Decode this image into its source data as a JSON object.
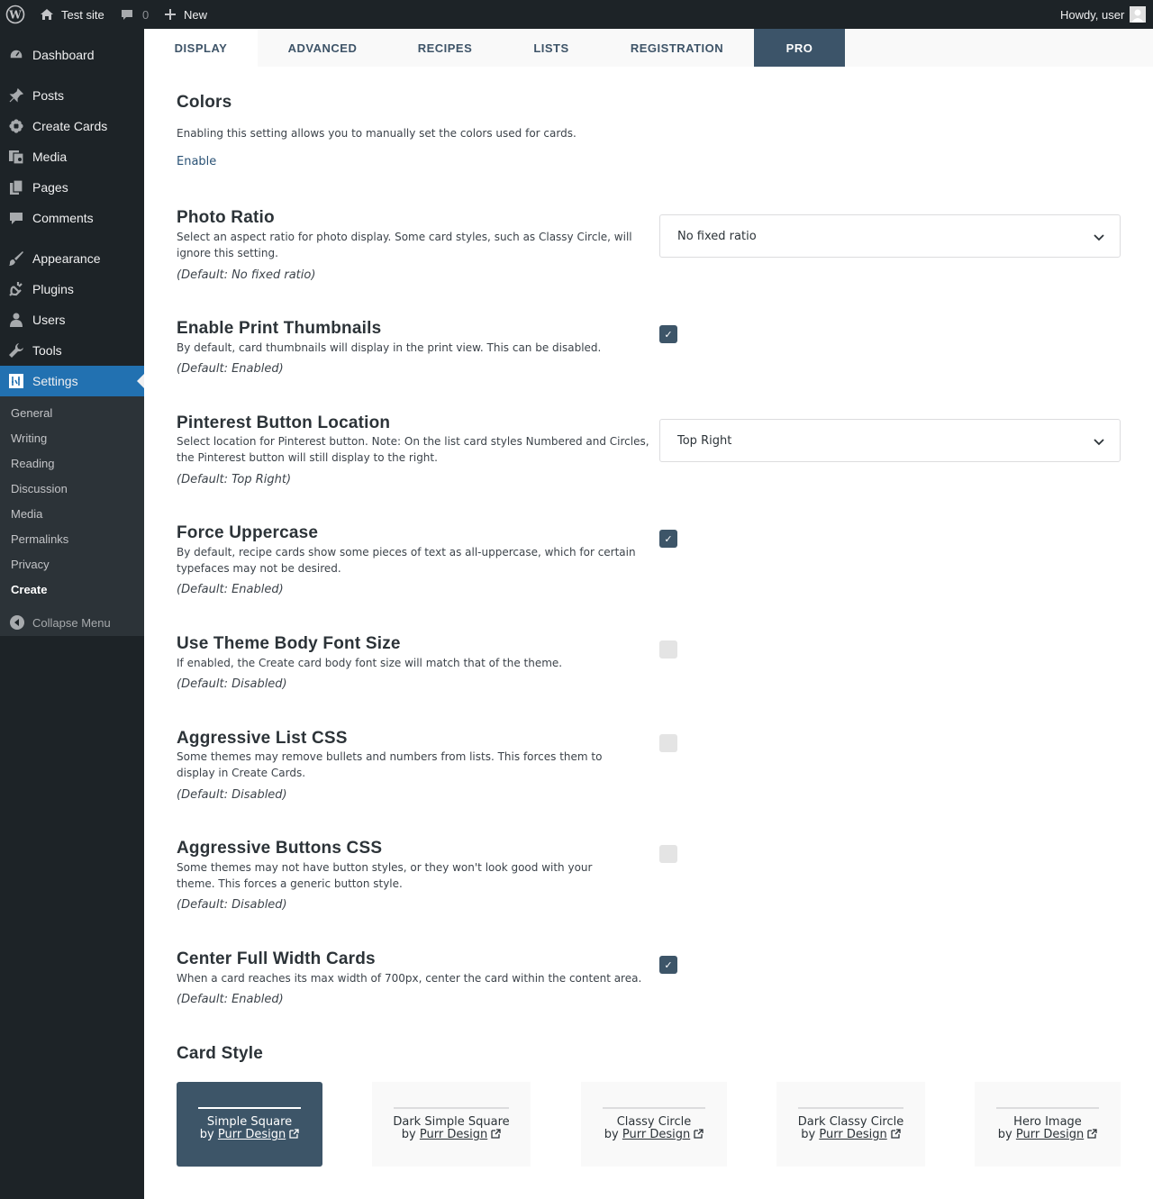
{
  "adminbar": {
    "site_name": "Test site",
    "comments_count": "0",
    "new_label": "New",
    "greeting": "Howdy, user"
  },
  "sidebar": {
    "items": [
      {
        "label": "Dashboard",
        "icon": "dashboard-icon"
      },
      {
        "label": "Posts",
        "icon": "pin-icon"
      },
      {
        "label": "Create Cards",
        "icon": "flower-icon"
      },
      {
        "label": "Media",
        "icon": "media-icon"
      },
      {
        "label": "Pages",
        "icon": "pages-icon"
      },
      {
        "label": "Comments",
        "icon": "comment-icon"
      },
      {
        "label": "Appearance",
        "icon": "brush-icon"
      },
      {
        "label": "Plugins",
        "icon": "plug-icon"
      },
      {
        "label": "Users",
        "icon": "user-icon"
      },
      {
        "label": "Tools",
        "icon": "wrench-icon"
      },
      {
        "label": "Settings",
        "icon": "settings-icon"
      }
    ],
    "submenu": [
      "General",
      "Writing",
      "Reading",
      "Discussion",
      "Media",
      "Permalinks",
      "Privacy",
      "Create"
    ],
    "collapse_label": "Collapse Menu"
  },
  "tabs": [
    "DISPLAY",
    "ADVANCED",
    "RECIPES",
    "LISTS",
    "REGISTRATION",
    "PRO"
  ],
  "colors": {
    "title": "Colors",
    "description": "Enabling this setting allows you to manually set the colors used for cards.",
    "enable_link": "Enable"
  },
  "settings": {
    "photo_ratio": {
      "title": "Photo Ratio",
      "description": "Select an aspect ratio for photo display. Some card styles, such as Classy Circle, will ignore this setting.",
      "default": "(Default: No fixed ratio)",
      "value": "No fixed ratio"
    },
    "print_thumbnails": {
      "title": "Enable Print Thumbnails",
      "description": "By default, card thumbnails will display in the print view. This can be disabled.",
      "default": "(Default: Enabled)",
      "checked": true
    },
    "pinterest_location": {
      "title": "Pinterest Button Location",
      "description": "Select location for Pinterest button. Note: On the list card styles Numbered and Circles, the Pinterest button will still display to the right.",
      "default": "(Default: Top Right)",
      "value": "Top Right"
    },
    "force_uppercase": {
      "title": "Force Uppercase",
      "description": "By default, recipe cards show some pieces of text as all-uppercase, which for certain typefaces may not be desired.",
      "default": "(Default: Enabled)",
      "checked": true
    },
    "theme_font_size": {
      "title": "Use Theme Body Font Size",
      "description": "If enabled, the Create card body font size will match that of the theme.",
      "default": "(Default: Disabled)",
      "checked": false
    },
    "aggressive_list": {
      "title": "Aggressive List CSS",
      "description": "Some themes may remove bullets and numbers from lists. This forces them to display in Create Cards.",
      "default": "(Default: Disabled)",
      "checked": false
    },
    "aggressive_buttons": {
      "title": "Aggressive Buttons CSS",
      "description": "Some themes may not have button styles, or they won't look good with your theme. This forces a generic button style.",
      "default": "(Default: Disabled)",
      "checked": false
    },
    "center_cards": {
      "title": "Center Full Width Cards",
      "description": "When a card reaches its max width of 700px, center the card within the content area.",
      "default": "(Default: Enabled)",
      "checked": true
    }
  },
  "card_style": {
    "title": "Card Style",
    "by_prefix": "by",
    "author": "Purr Design",
    "cards": [
      "Simple Square",
      "Dark Simple Square",
      "Classy Circle",
      "Dark Classy Circle",
      "Hero Image"
    ],
    "selected": "Simple Square"
  },
  "colors_palette": {
    "accent": "#3d5568",
    "admin_bg": "#1d2327",
    "active_menu": "#2271b1"
  }
}
